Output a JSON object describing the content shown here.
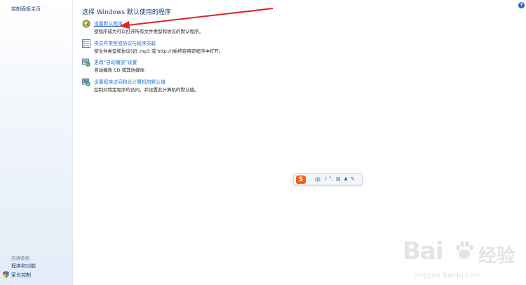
{
  "sidebar": {
    "home_label": "控制面板主页",
    "see_also_label": "另请参阅",
    "links": [
      {
        "label": "程序和功能"
      },
      {
        "label": "家长控制",
        "icon": "shield-icon"
      }
    ]
  },
  "help": {
    "label": "?"
  },
  "main": {
    "title": "选择 Windows 默认使用的程序",
    "options": [
      {
        "link": "设置默认程序",
        "desc": "使程序成为可以打开所有文件类型和协议的默认程序。",
        "icon": "default-programs-icon"
      },
      {
        "link": "将文件类型或协议与程序关联",
        "desc": "使文件类型和协议(如 .mp3 或 http://)始终在特定程序中打开。",
        "icon": "file-association-icon"
      },
      {
        "link": "更改“自动播放”设置",
        "desc": "自动播放 CD 或其他媒体",
        "icon": "autoplay-icon"
      },
      {
        "link": "设置程序访问和此计算机的默认值",
        "desc": "控制对特定程序的访问，并设置此计算机的默认值。",
        "icon": "program-access-icon"
      }
    ]
  },
  "ime_toolbar": {
    "logo": "S",
    "mode": "中",
    "icons": [
      "moon-icon",
      "punctuation-icon",
      "keyboard-icon",
      "user-icon",
      "wrench-icon"
    ]
  },
  "watermark": {
    "brand_latin": "Bai",
    "brand_cn": "经验",
    "url": "jingyan.baidu.com"
  },
  "colors": {
    "link": "#1b6bd6",
    "title": "#19407c",
    "annotation_arrow": "#d9262b",
    "sidebar_bg": "#e3ecf7"
  }
}
